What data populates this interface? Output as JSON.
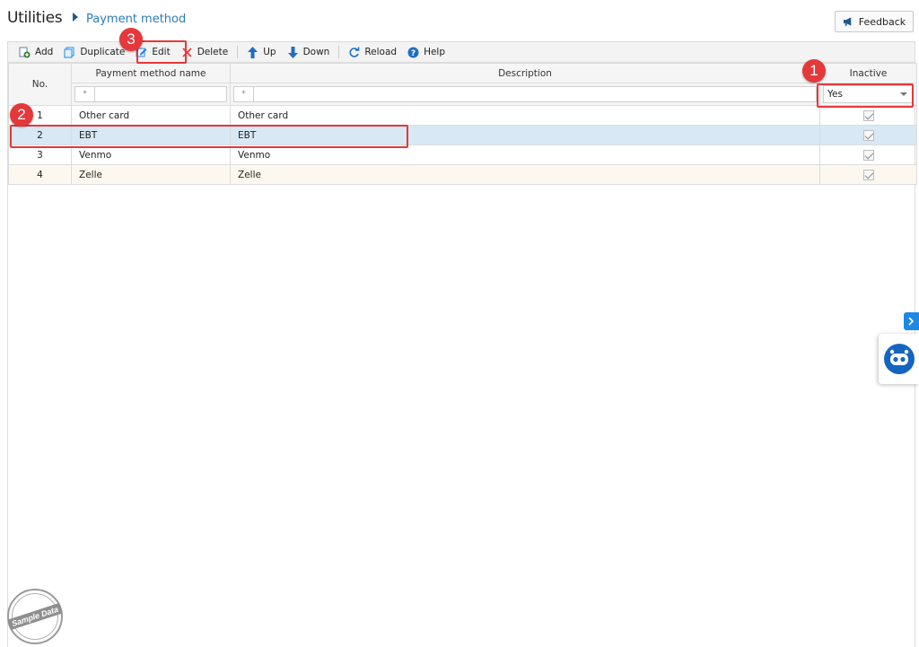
{
  "header": {
    "breadcrumb_root": "Utilities",
    "breadcrumb_page": "Payment method",
    "feedback_label": "Feedback"
  },
  "toolbar": {
    "add": "Add",
    "duplicate": "Duplicate",
    "edit": "Edit",
    "delete": "Delete",
    "up": "Up",
    "down": "Down",
    "reload": "Reload",
    "help": "Help"
  },
  "grid": {
    "columns": {
      "no": "No.",
      "name": "Payment method name",
      "description": "Description",
      "inactive": "Inactive"
    },
    "filters": {
      "name_op": "*",
      "description_op": "*",
      "inactive_value": "Yes"
    },
    "rows": [
      {
        "no": "1",
        "name": "Other card",
        "description": "Other card",
        "inactive": true
      },
      {
        "no": "2",
        "name": "EBT",
        "description": "EBT",
        "inactive": true
      },
      {
        "no": "3",
        "name": "Venmo",
        "description": "Venmo",
        "inactive": true
      },
      {
        "no": "4",
        "name": "Zelle",
        "description": "Zelle",
        "inactive": true
      }
    ]
  },
  "annotations": {
    "step1": "1",
    "step2": "2",
    "step3": "3"
  },
  "watermark": "Sample Data",
  "colors": {
    "accent": "#2b7bb9",
    "highlight": "#e5383b",
    "selected_row": "#d8e8f4",
    "alt_row": "#fdf8ef"
  }
}
